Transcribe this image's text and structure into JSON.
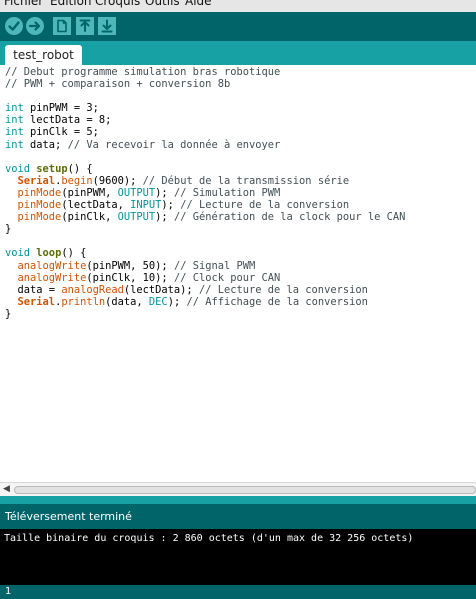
{
  "menubar": {
    "items": [
      {
        "label": "Fichier"
      },
      {
        "label": "Edition"
      },
      {
        "label": "Croquis"
      },
      {
        "label": "Outils"
      },
      {
        "label": "Aide"
      }
    ]
  },
  "toolbar": {
    "buttons": [
      {
        "name": "verify",
        "icon": "checkmark-icon"
      },
      {
        "name": "upload",
        "icon": "arrow-right-icon"
      },
      {
        "name": "new",
        "icon": "new-file-icon"
      },
      {
        "name": "open",
        "icon": "arrow-up-icon"
      },
      {
        "name": "save",
        "icon": "arrow-down-icon"
      }
    ]
  },
  "tab": {
    "label": "test_robot"
  },
  "editor": {
    "lines": [
      [
        {
          "t": "// Debut programme simulation bras robotique",
          "c": "comment"
        }
      ],
      [
        {
          "t": "// PWM + comparaison + conversion 8b",
          "c": "comment"
        }
      ],
      [],
      [
        {
          "t": "int",
          "c": "type"
        },
        {
          "t": " pinPWM = 3;"
        }
      ],
      [
        {
          "t": "int",
          "c": "type"
        },
        {
          "t": " lectData = 8;"
        }
      ],
      [
        {
          "t": "int",
          "c": "type"
        },
        {
          "t": " pinClk = 5;"
        }
      ],
      [
        {
          "t": "int",
          "c": "type"
        },
        {
          "t": " data; "
        },
        {
          "t": "// Va recevoir la donnée à envoyer",
          "c": "comment"
        }
      ],
      [],
      [
        {
          "t": "void",
          "c": "type"
        },
        {
          "t": " "
        },
        {
          "t": "setup",
          "c": "kw"
        },
        {
          "t": "() {"
        }
      ],
      [
        {
          "t": "  "
        },
        {
          "t": "Serial",
          "c": "obj"
        },
        {
          "t": "."
        },
        {
          "t": "begin",
          "c": "fn"
        },
        {
          "t": "(9600); "
        },
        {
          "t": "// Début de la transmission série",
          "c": "comment"
        }
      ],
      [
        {
          "t": "  "
        },
        {
          "t": "pinMode",
          "c": "fn"
        },
        {
          "t": "(pinPWM, "
        },
        {
          "t": "OUTPUT",
          "c": "const"
        },
        {
          "t": "); "
        },
        {
          "t": "// Simulation PWM",
          "c": "comment"
        }
      ],
      [
        {
          "t": "  "
        },
        {
          "t": "pinMode",
          "c": "fn"
        },
        {
          "t": "(lectData, "
        },
        {
          "t": "INPUT",
          "c": "const"
        },
        {
          "t": "); "
        },
        {
          "t": "// Lecture de la conversion",
          "c": "comment"
        }
      ],
      [
        {
          "t": "  "
        },
        {
          "t": "pinMode",
          "c": "fn"
        },
        {
          "t": "(pinClk, "
        },
        {
          "t": "OUTPUT",
          "c": "const"
        },
        {
          "t": "); "
        },
        {
          "t": "// Génération de la clock pour le CAN",
          "c": "comment"
        }
      ],
      [
        {
          "t": "}"
        }
      ],
      [],
      [
        {
          "t": "void",
          "c": "type"
        },
        {
          "t": " "
        },
        {
          "t": "loop",
          "c": "kw"
        },
        {
          "t": "() {"
        }
      ],
      [
        {
          "t": "  "
        },
        {
          "t": "analogWrite",
          "c": "fn"
        },
        {
          "t": "(pinPWM, 50); "
        },
        {
          "t": "// Signal PWM",
          "c": "comment"
        }
      ],
      [
        {
          "t": "  "
        },
        {
          "t": "analogWrite",
          "c": "fn"
        },
        {
          "t": "(pinClk, 10); "
        },
        {
          "t": "// Clock pour CAN",
          "c": "comment"
        }
      ],
      [
        {
          "t": "  data = "
        },
        {
          "t": "analogRead",
          "c": "fn"
        },
        {
          "t": "(lectData); "
        },
        {
          "t": "// Lecture de la conversion",
          "c": "comment"
        }
      ],
      [
        {
          "t": "  "
        },
        {
          "t": "Serial",
          "c": "obj"
        },
        {
          "t": "."
        },
        {
          "t": "println",
          "c": "fn"
        },
        {
          "t": "(data, "
        },
        {
          "t": "DEC",
          "c": "const"
        },
        {
          "t": "); "
        },
        {
          "t": "// Affichage de la conversion",
          "c": "comment"
        }
      ],
      [
        {
          "t": "}"
        }
      ]
    ]
  },
  "status": {
    "message": "Téléversement terminé"
  },
  "console": {
    "text": "Taille binaire du croquis : 2 860 octets (d'un max de 32 256 octets)"
  },
  "footer": {
    "line_number": "1"
  },
  "colors": {
    "toolbar": "#006468",
    "tabbar": "#17a1a5",
    "button": "#4db7bb",
    "comment": "#434f54",
    "type": "#00979c",
    "function": "#d35400",
    "keyword": "#5e6d03"
  }
}
